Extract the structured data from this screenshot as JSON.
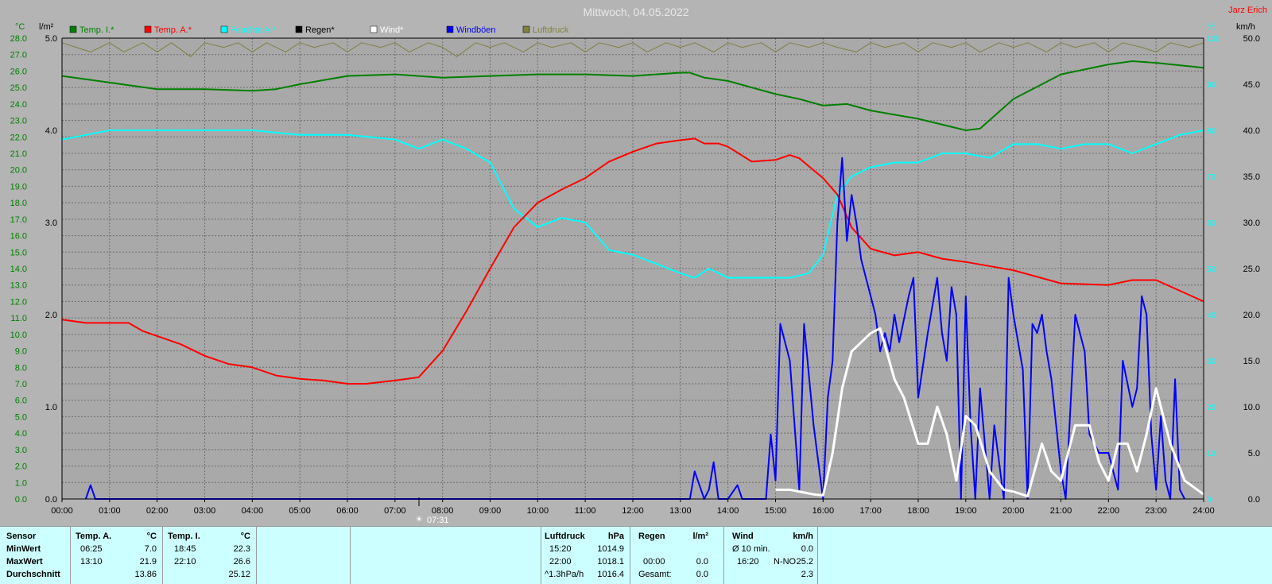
{
  "header": {
    "title": "Mittwoch, 04.05.2022",
    "author": "Jarz Erich",
    "left_unit_temp": "°C",
    "left_unit_rain": "l/m²",
    "right_unit_humidity": "%",
    "right_unit_wind": "km/h"
  },
  "legend": [
    {
      "label": "Temp. I.*",
      "color": "#008000"
    },
    {
      "label": "Temp. A.*",
      "color": "#ff0000"
    },
    {
      "label": "Feuchte A.*",
      "color": "#00ffff"
    },
    {
      "label": "Regen*",
      "color": "#000000"
    },
    {
      "label": "Wind*",
      "color": "#ffffff"
    },
    {
      "label": "Windböen",
      "color": "#0000ff"
    },
    {
      "label": "Luftdruck",
      "color": "#808040"
    }
  ],
  "sunrise_label": "07:31",
  "chart_data": {
    "type": "line",
    "title": "Mittwoch, 04.05.2022",
    "x_ticks": [
      "00:00",
      "01:00",
      "02:00",
      "03:00",
      "04:00",
      "05:00",
      "06:00",
      "07:00",
      "08:00",
      "09:00",
      "10:00",
      "11:00",
      "12:00",
      "13:00",
      "14:00",
      "15:00",
      "16:00",
      "17:00",
      "18:00",
      "19:00",
      "20:00",
      "21:00",
      "22:00",
      "23:00",
      "24:00"
    ],
    "xlim": [
      0,
      24
    ],
    "axes": {
      "temp": {
        "unit": "°C",
        "ylim": [
          0,
          28
        ],
        "ticks": [
          "0.0",
          "1.0",
          "2.0",
          "3.0",
          "4.0",
          "5.0",
          "6.0",
          "7.0",
          "8.0",
          "9.0",
          "10.0",
          "11.0",
          "12.0",
          "13.0",
          "14.0",
          "15.0",
          "16.0",
          "17.0",
          "18.0",
          "19.0",
          "20.0",
          "21.0",
          "22.0",
          "23.0",
          "24.0",
          "25.0",
          "26.0",
          "27.0",
          "28.0"
        ]
      },
      "rain": {
        "unit": "l/m²",
        "ylim": [
          0,
          5
        ],
        "ticks": [
          "0.0",
          "1.0",
          "2.0",
          "3.0",
          "4.0",
          "5.0"
        ]
      },
      "humidity": {
        "unit": "%",
        "ylim": [
          0,
          100
        ],
        "ticks": [
          "0",
          "10",
          "20",
          "30",
          "40",
          "50",
          "60",
          "70",
          "80",
          "90",
          "100"
        ]
      },
      "wind": {
        "unit": "km/h",
        "ylim": [
          0,
          50
        ],
        "ticks": [
          "0.0",
          "5.0",
          "10.0",
          "15.0",
          "20.0",
          "25.0",
          "30.0",
          "35.0",
          "40.0",
          "45.0",
          "50.0"
        ]
      }
    },
    "grid": true,
    "series": [
      {
        "name": "Temp. I.*",
        "axis": "temp",
        "color": "#008000",
        "x": [
          0,
          1,
          2,
          3,
          4,
          4.5,
          5,
          6,
          7,
          8,
          9,
          10,
          11,
          12,
          13,
          13.2,
          13.5,
          14,
          15,
          15.5,
          16,
          16.5,
          17,
          18,
          19,
          19.3,
          20,
          21,
          22,
          22.5,
          23,
          24
        ],
        "y": [
          25.7,
          25.3,
          24.9,
          24.9,
          24.8,
          24.9,
          25.2,
          25.7,
          25.8,
          25.6,
          25.7,
          25.8,
          25.8,
          25.7,
          25.9,
          25.9,
          25.6,
          25.4,
          24.6,
          24.3,
          23.9,
          24.0,
          23.6,
          23.1,
          22.4,
          22.5,
          24.3,
          25.8,
          26.4,
          26.6,
          26.5,
          26.2
        ]
      },
      {
        "name": "Temp. A.*",
        "axis": "temp",
        "color": "#ff0000",
        "x": [
          0,
          0.5,
          1,
          1.4,
          1.7,
          2,
          2.5,
          3,
          3.5,
          4,
          4.5,
          5,
          5.5,
          6,
          6.4,
          6.7,
          7,
          7.5,
          8,
          8.5,
          9,
          9.5,
          10,
          10.5,
          11,
          11.5,
          12,
          12.5,
          13,
          13.3,
          13.5,
          13.8,
          14,
          14.5,
          15,
          15.3,
          15.5,
          16,
          16.3,
          16.6,
          17,
          17.5,
          18,
          18.5,
          19,
          20,
          21,
          22,
          22.5,
          23,
          24
        ],
        "y": [
          10.9,
          10.7,
          10.7,
          10.7,
          10.2,
          9.9,
          9.4,
          8.7,
          8.2,
          8.0,
          7.5,
          7.3,
          7.2,
          7.0,
          7.0,
          7.1,
          7.2,
          7.4,
          9.0,
          11.4,
          14.0,
          16.5,
          18.0,
          18.8,
          19.5,
          20.5,
          21.1,
          21.6,
          21.8,
          21.9,
          21.6,
          21.6,
          21.4,
          20.5,
          20.6,
          20.9,
          20.7,
          19.5,
          18.5,
          16.5,
          15.2,
          14.8,
          15.0,
          14.6,
          14.4,
          13.9,
          13.1,
          13.0,
          13.3,
          13.3,
          12.0
        ]
      },
      {
        "name": "Feuchte A.*",
        "axis": "humidity",
        "color": "#00ffff",
        "x": [
          0,
          0.5,
          1,
          2,
          3,
          4,
          5,
          6,
          7,
          7.5,
          8,
          8.5,
          9,
          9.5,
          10,
          10.5,
          11,
          11.5,
          12,
          12.5,
          13,
          13.3,
          13.6,
          14,
          14.5,
          15,
          15.3,
          15.7,
          16,
          16.3,
          16.6,
          17,
          17.5,
          18,
          18.5,
          19,
          19.5,
          20,
          20.5,
          21,
          21.5,
          22,
          22.5,
          23,
          23.5,
          24
        ],
        "y": [
          78,
          79,
          80,
          80,
          80,
          80,
          79,
          79,
          78,
          76,
          78,
          76,
          73,
          63,
          59,
          61,
          60,
          54,
          53,
          51,
          49,
          48,
          50,
          48,
          48,
          48,
          48,
          49,
          53,
          66,
          70,
          72,
          73,
          73,
          75,
          75,
          74,
          77,
          77,
          76,
          77,
          77,
          75,
          77,
          79,
          80
        ]
      },
      {
        "name": "Wind*",
        "axis": "wind",
        "color": "#ffffff",
        "x": [
          15,
          15.3,
          15.5,
          15.8,
          16,
          16.2,
          16.4,
          16.6,
          17,
          17.2,
          17.5,
          17.7,
          18,
          18.2,
          18.4,
          18.6,
          18.8,
          19,
          19.2,
          19.5,
          19.8,
          20,
          20.3,
          20.6,
          20.8,
          21,
          21.3,
          21.6,
          21.8,
          22,
          22.2,
          22.4,
          22.6,
          22.8,
          23,
          23.3,
          23.6,
          24
        ],
        "y": [
          1,
          1,
          0.8,
          0.5,
          0.4,
          5,
          12,
          16,
          18,
          18.5,
          13,
          11,
          6,
          6,
          10,
          7,
          2,
          9,
          8,
          3,
          1,
          0.8,
          0.3,
          6,
          3,
          2,
          8,
          8,
          4,
          2,
          6,
          6,
          3,
          7,
          12,
          6,
          2,
          0.5
        ]
      },
      {
        "name": "Windböen",
        "axis": "wind",
        "color": "#0000ff",
        "x": [
          0.5,
          0.6,
          0.7,
          13.2,
          13.3,
          13.5,
          13.6,
          13.7,
          13.8,
          14,
          14.2,
          14.3,
          14.8,
          14.9,
          15,
          15.1,
          15.3,
          15.5,
          15.6,
          15.8,
          16,
          16.1,
          16.2,
          16.3,
          16.4,
          16.5,
          16.6,
          16.7,
          16.8,
          16.9,
          17,
          17.1,
          17.2,
          17.3,
          17.4,
          17.5,
          17.6,
          17.8,
          17.9,
          18,
          18.2,
          18.4,
          18.5,
          18.6,
          18.7,
          18.8,
          18.9,
          19,
          19.1,
          19.2,
          19.3,
          19.5,
          19.6,
          19.8,
          19.9,
          20,
          20.2,
          20.3,
          20.4,
          20.5,
          20.6,
          20.7,
          20.8,
          21,
          21.1,
          21.2,
          21.3,
          21.4,
          21.5,
          21.6,
          21.8,
          22,
          22.1,
          22.2,
          22.3,
          22.5,
          22.6,
          22.7,
          22.8,
          22.9,
          23,
          23.1,
          23.2,
          23.3,
          23.4,
          23.5,
          23.6
        ],
        "y": [
          0,
          1.5,
          0,
          0,
          3,
          0,
          1,
          4,
          0,
          0,
          1.5,
          0,
          0,
          7,
          2,
          19,
          15,
          1,
          19,
          8,
          0,
          11,
          15,
          30,
          37,
          28,
          33,
          30,
          26,
          24,
          22,
          20,
          16,
          18,
          16,
          20,
          17,
          22,
          24,
          11,
          18,
          24,
          18,
          15,
          23,
          20,
          0,
          22,
          8,
          0,
          12,
          0,
          8,
          0,
          24,
          20,
          14,
          0,
          19,
          18,
          20,
          16,
          13,
          3,
          0,
          10,
          20,
          18,
          16,
          7,
          5,
          5,
          3,
          1,
          15,
          10,
          12,
          22,
          20,
          7,
          1,
          9,
          2,
          0,
          13,
          1,
          0
        ]
      },
      {
        "name": "Luftdruck",
        "axis": "humidity",
        "color": "#808040",
        "x": [
          0,
          0.3,
          0.6,
          1,
          1.3,
          1.7,
          2,
          2.3,
          2.7,
          3,
          3.4,
          3.7,
          4,
          4.3,
          4.7,
          5,
          5.3,
          5.7,
          6,
          6.3,
          6.7,
          7,
          7.3,
          7.7,
          8,
          8.3,
          8.7,
          9,
          9.3,
          9.7,
          10,
          10.3,
          10.7,
          11,
          11.3,
          11.7,
          12,
          12.3,
          12.7,
          13,
          13.3,
          13.7,
          14,
          14.3,
          14.7,
          15,
          15.3,
          15.7,
          16,
          16.3,
          16.7,
          17,
          17.3,
          17.7,
          18,
          18.3,
          18.7,
          19,
          19.3,
          19.7,
          20,
          20.3,
          20.7,
          21,
          21.3,
          21.7,
          22,
          22.3,
          22.7,
          23,
          23.3,
          23.7,
          24
        ],
        "y": [
          99,
          98,
          97,
          99,
          97,
          99,
          97,
          99,
          96,
          99,
          98,
          99,
          97,
          99,
          97,
          99,
          98,
          99,
          97,
          99,
          98,
          99,
          97,
          99,
          98,
          96,
          99,
          98,
          99,
          97,
          99,
          98,
          99,
          97,
          99,
          98,
          99,
          97,
          99,
          98,
          99,
          97,
          99,
          98,
          99,
          97,
          99,
          98,
          99,
          98,
          97,
          99,
          98,
          99,
          97,
          99,
          98,
          99,
          97,
          99,
          98,
          99,
          97,
          99,
          98,
          99,
          97,
          99,
          98,
          97,
          99,
          98,
          99
        ]
      }
    ]
  },
  "stats": {
    "sensor_label": "Sensor",
    "row_labels": [
      "MinWert",
      "MaxWert",
      "Durchschnitt"
    ],
    "temp_a": {
      "header": "Temp. A.",
      "unit": "°C",
      "min_time": "06:25",
      "min": "7.0",
      "max_time": "13:10",
      "max": "21.9",
      "avg": "13.86"
    },
    "temp_i": {
      "header": "Temp. I.",
      "unit": "°C",
      "min_time": "18:45",
      "min": "22.3",
      "max_time": "22:10",
      "max": "26.6",
      "avg": "25.12"
    },
    "pressure": {
      "header": "Luftdruck",
      "unit": "hPa",
      "min_time": "15:20",
      "min": "1014.9",
      "max_time": "22:00",
      "max": "1018.1",
      "avg_label": "^1.3hPa/h",
      "avg": "1016.4"
    },
    "rain": {
      "header": "Regen",
      "unit": "l/m²",
      "time": "00:00",
      "value": "0.0",
      "total_label": "Gesamt:",
      "total": "0.0"
    },
    "wind": {
      "header": "Wind",
      "unit": "km/h",
      "avg_label": "Ø 10 min.",
      "avg": "0.0",
      "max_time": "16:20",
      "max_dir": "N-NO",
      "max": "25.2",
      "mean": "2.3"
    }
  }
}
